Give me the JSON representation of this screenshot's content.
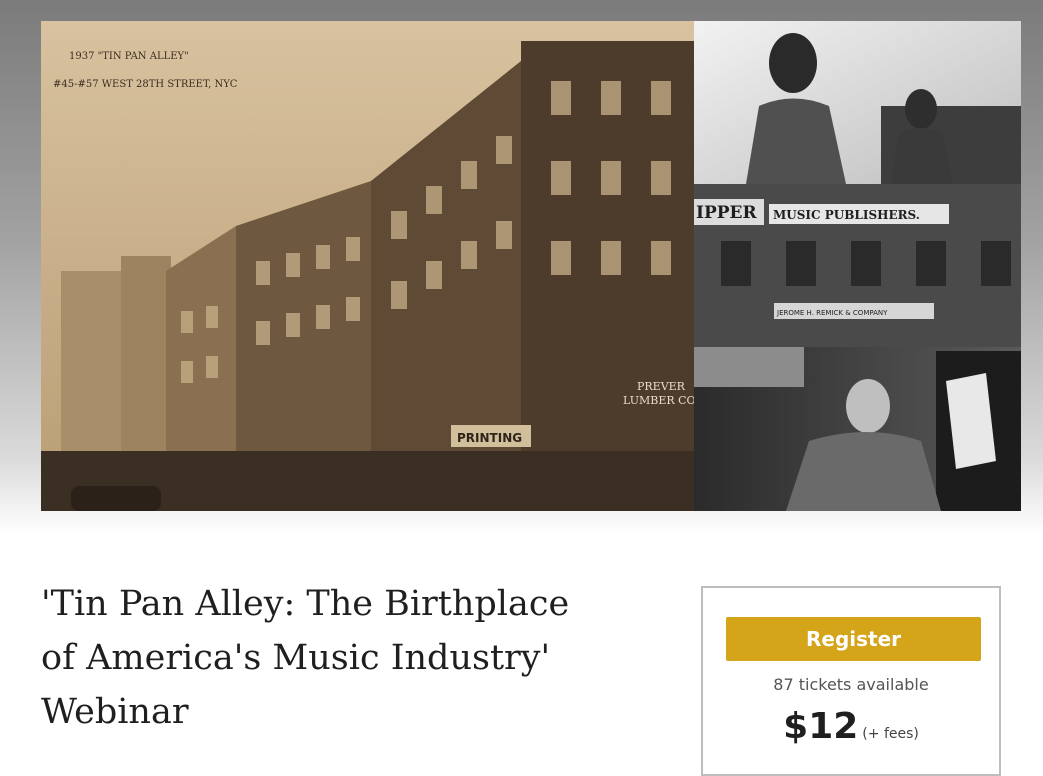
{
  "hero": {
    "photo_caption_line1": "1937 \"TIN PAN ALLEY\"",
    "photo_caption_line2": "#45-#57 WEST 28TH STREET, NYC",
    "sign_music_publishers": "MUSIC PUBLISHERS.",
    "sign_ipper": "IPPER",
    "sign_remick": "JEROME H. REMICK & COMPANY",
    "sign_printing": "PRINTING",
    "sign_prever": "PREVER",
    "sign_lumber": "LUMBER CO"
  },
  "event": {
    "title": "'Tin Pan Alley: The Birthplace of America's Music Industry' Webinar"
  },
  "tickets": {
    "register_label": "Register",
    "available_text": "87 tickets available",
    "price": "$12",
    "fees_note": "(+ fees)"
  },
  "colors": {
    "register_button": "#d4a419",
    "sepia_photo": "#c2a47a",
    "bw_photo": "#6b6b6b"
  }
}
